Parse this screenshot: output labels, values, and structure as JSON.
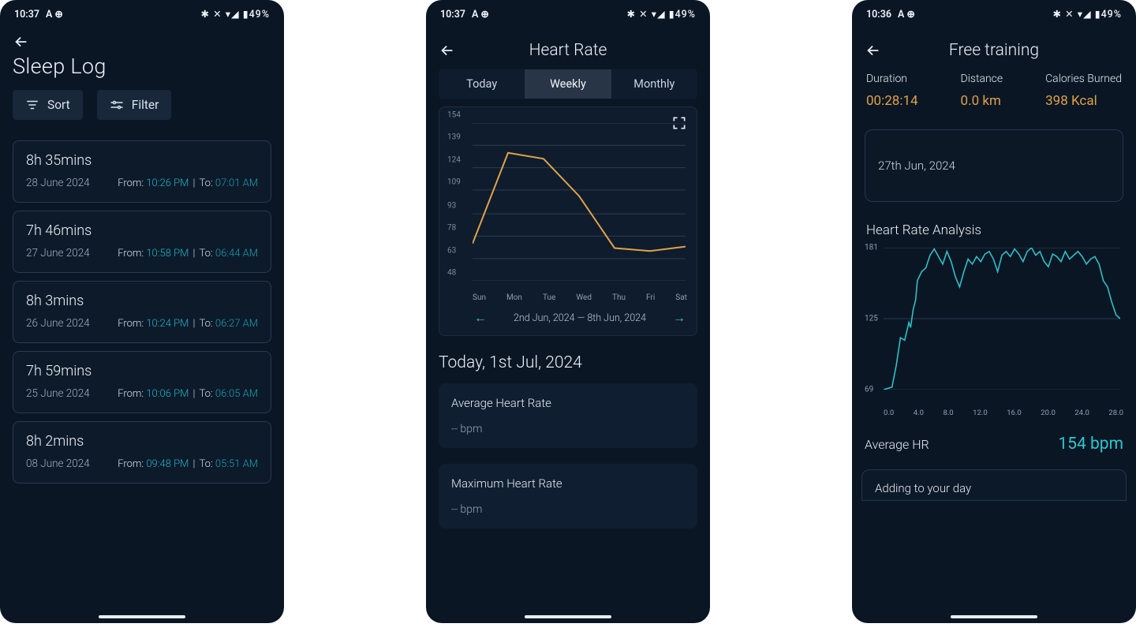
{
  "status": {
    "time1": "10:37",
    "time3": "10:36",
    "iconsA": "A  ⊕",
    "right": "✱ ✕ ▾◢ ▮49%"
  },
  "screen1": {
    "title": "Sleep Log",
    "sort": "Sort",
    "filter": "Filter",
    "entries": [
      {
        "dur": "8h 35mins",
        "date": "28 June 2024",
        "from_lbl": "From:",
        "from": "10:26 PM",
        "to_lbl": "To:",
        "to": "07:01 AM"
      },
      {
        "dur": "7h 46mins",
        "date": "27 June 2024",
        "from_lbl": "From:",
        "from": "10:58 PM",
        "to_lbl": "To:",
        "to": "06:44 AM"
      },
      {
        "dur": "8h 3mins",
        "date": "26 June 2024",
        "from_lbl": "From:",
        "from": "10:24 PM",
        "to_lbl": "To:",
        "to": "06:27 AM"
      },
      {
        "dur": "7h 59mins",
        "date": "25 June 2024",
        "from_lbl": "From:",
        "from": "10:06 PM",
        "to_lbl": "To:",
        "to": "06:05 AM"
      },
      {
        "dur": "8h 2mins",
        "date": "08 June 2024",
        "from_lbl": "From:",
        "from": "09:48 PM",
        "to_lbl": "To:",
        "to": "05:51 AM"
      }
    ]
  },
  "screen2": {
    "title": "Heart Rate",
    "tabs": {
      "today": "Today",
      "weekly": "Weekly",
      "monthly": "Monthly"
    },
    "range": "2nd Jun, 2024 — 8th Jun, 2024",
    "today_label": "Today, 1st Jul, 2024",
    "avg_card": {
      "k": "Average Heart Rate",
      "v": "-- bpm"
    },
    "max_card": {
      "k": "Maximum Heart Rate",
      "v": "-- bpm"
    }
  },
  "screen3": {
    "title": "Free training",
    "metrics": {
      "dur_k": "Duration",
      "dur_v": "00:28:14",
      "dist_k": "Distance",
      "dist_v": "0.0 km",
      "cal_k": "Calories Burned",
      "cal_v": "398 Kcal"
    },
    "date": "27th Jun, 2024",
    "hr_header": "Heart Rate Analysis",
    "avg_k": "Average HR",
    "avg_v": "154 bpm",
    "adding": "Adding to your day"
  },
  "chart_data": [
    {
      "type": "line",
      "title": "Weekly Heart Rate",
      "categories": [
        "Sun",
        "Mon",
        "Tue",
        "Wed",
        "Thu",
        "Fri",
        "Sat"
      ],
      "values": [
        73,
        134,
        130,
        105,
        70,
        68,
        71
      ],
      "yticks": [
        154,
        139,
        124,
        109,
        93,
        78,
        63,
        48
      ],
      "ylim": [
        48,
        154
      ],
      "xlabel": "",
      "ylabel": ""
    },
    {
      "type": "line",
      "title": "Heart Rate Analysis",
      "x": [
        0.0,
        0.5,
        1.0,
        1.5,
        2.0,
        2.5,
        3.0,
        3.2,
        3.5,
        3.8,
        4.0,
        4.5,
        5.0,
        5.5,
        6.0,
        6.5,
        7.0,
        7.5,
        8.0,
        8.5,
        9.0,
        9.5,
        10.0,
        10.5,
        11.0,
        11.5,
        12.0,
        12.5,
        13.0,
        13.5,
        14.0,
        14.5,
        15.0,
        15.5,
        16.0,
        16.5,
        17.0,
        17.5,
        18.0,
        18.5,
        19.0,
        19.5,
        20.0,
        20.5,
        21.0,
        21.5,
        22.0,
        22.5,
        23.0,
        23.5,
        24.0,
        24.5,
        25.0,
        25.5,
        26.0,
        26.5,
        27.0,
        27.5,
        28.0
      ],
      "values": [
        69,
        70,
        71,
        88,
        110,
        108,
        122,
        118,
        132,
        140,
        155,
        162,
        165,
        175,
        180,
        174,
        168,
        178,
        170,
        158,
        150,
        162,
        172,
        168,
        174,
        170,
        176,
        178,
        172,
        162,
        175,
        178,
        174,
        180,
        176,
        170,
        178,
        181,
        175,
        178,
        170,
        166,
        176,
        174,
        170,
        178,
        172,
        175,
        178,
        174,
        168,
        172,
        174,
        168,
        155,
        150,
        138,
        128,
        125
      ],
      "yticks": [
        181,
        125,
        69
      ],
      "xticks": [
        0.0,
        4.0,
        8.0,
        12.0,
        16.0,
        20.0,
        24.0,
        28.0
      ],
      "ylim": [
        69,
        181
      ],
      "xlim": [
        0,
        28
      ],
      "xlabel": "",
      "ylabel": ""
    }
  ]
}
